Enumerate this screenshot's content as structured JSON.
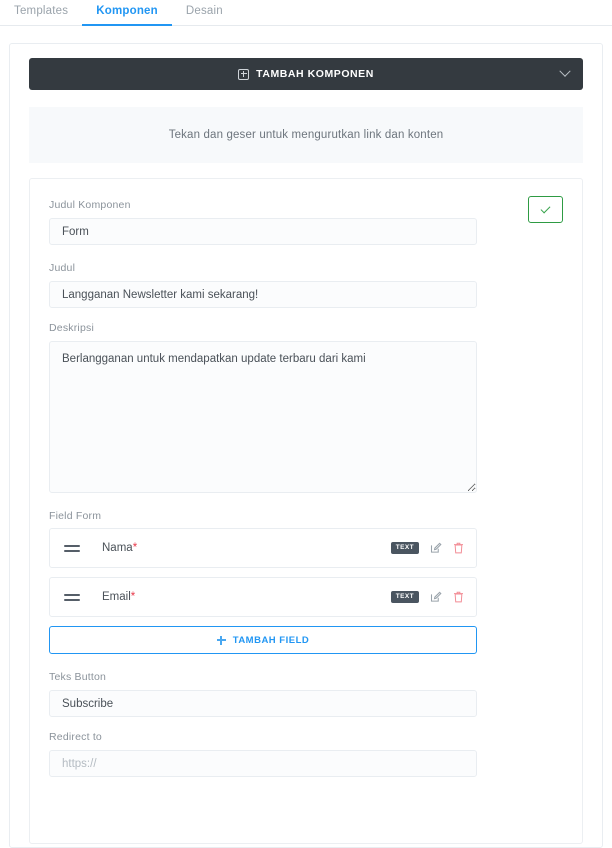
{
  "tabs": [
    {
      "label": "Templates",
      "active": false
    },
    {
      "label": "Komponen",
      "active": true
    },
    {
      "label": "Desain",
      "active": false
    }
  ],
  "add_component_bar": {
    "label": "TAMBAH KOMPONEN",
    "plus_icon": "plus-box-icon",
    "chevron_icon": "chevron-down-icon",
    "background_color": "#343a40"
  },
  "hint_banner": {
    "text": "Tekan dan geser untuk mengurutkan link dan konten"
  },
  "editor": {
    "save_button": {
      "icon": "check-icon",
      "border_color": "#2e9b43"
    },
    "judul_komponen": {
      "label": "Judul Komponen",
      "value": "Form"
    },
    "judul": {
      "label": "Judul",
      "value": "Langganan Newsletter kami sekarang!"
    },
    "deskripsi": {
      "label": "Deskripsi",
      "value": "Berlangganan untuk mendapatkan update terbaru dari kami"
    },
    "field_form": {
      "label": "Field Form",
      "rows": [
        {
          "label": "Nama",
          "required_mark": "*",
          "type_badge": "TEXT",
          "edit_icon": "edit-icon",
          "delete_icon": "trash-icon"
        },
        {
          "label": "Email",
          "required_mark": "*",
          "type_badge": "TEXT",
          "edit_icon": "edit-icon",
          "delete_icon": "trash-icon"
        }
      ],
      "add_button": {
        "label": "TAMBAH FIELD",
        "icon": "plus-icon",
        "accent_color": "#2196f3"
      }
    },
    "teks_button": {
      "label": "Teks Button",
      "value": "Subscribe"
    },
    "redirect_to": {
      "label": "Redirect to",
      "value": "",
      "placeholder": "https://"
    }
  }
}
